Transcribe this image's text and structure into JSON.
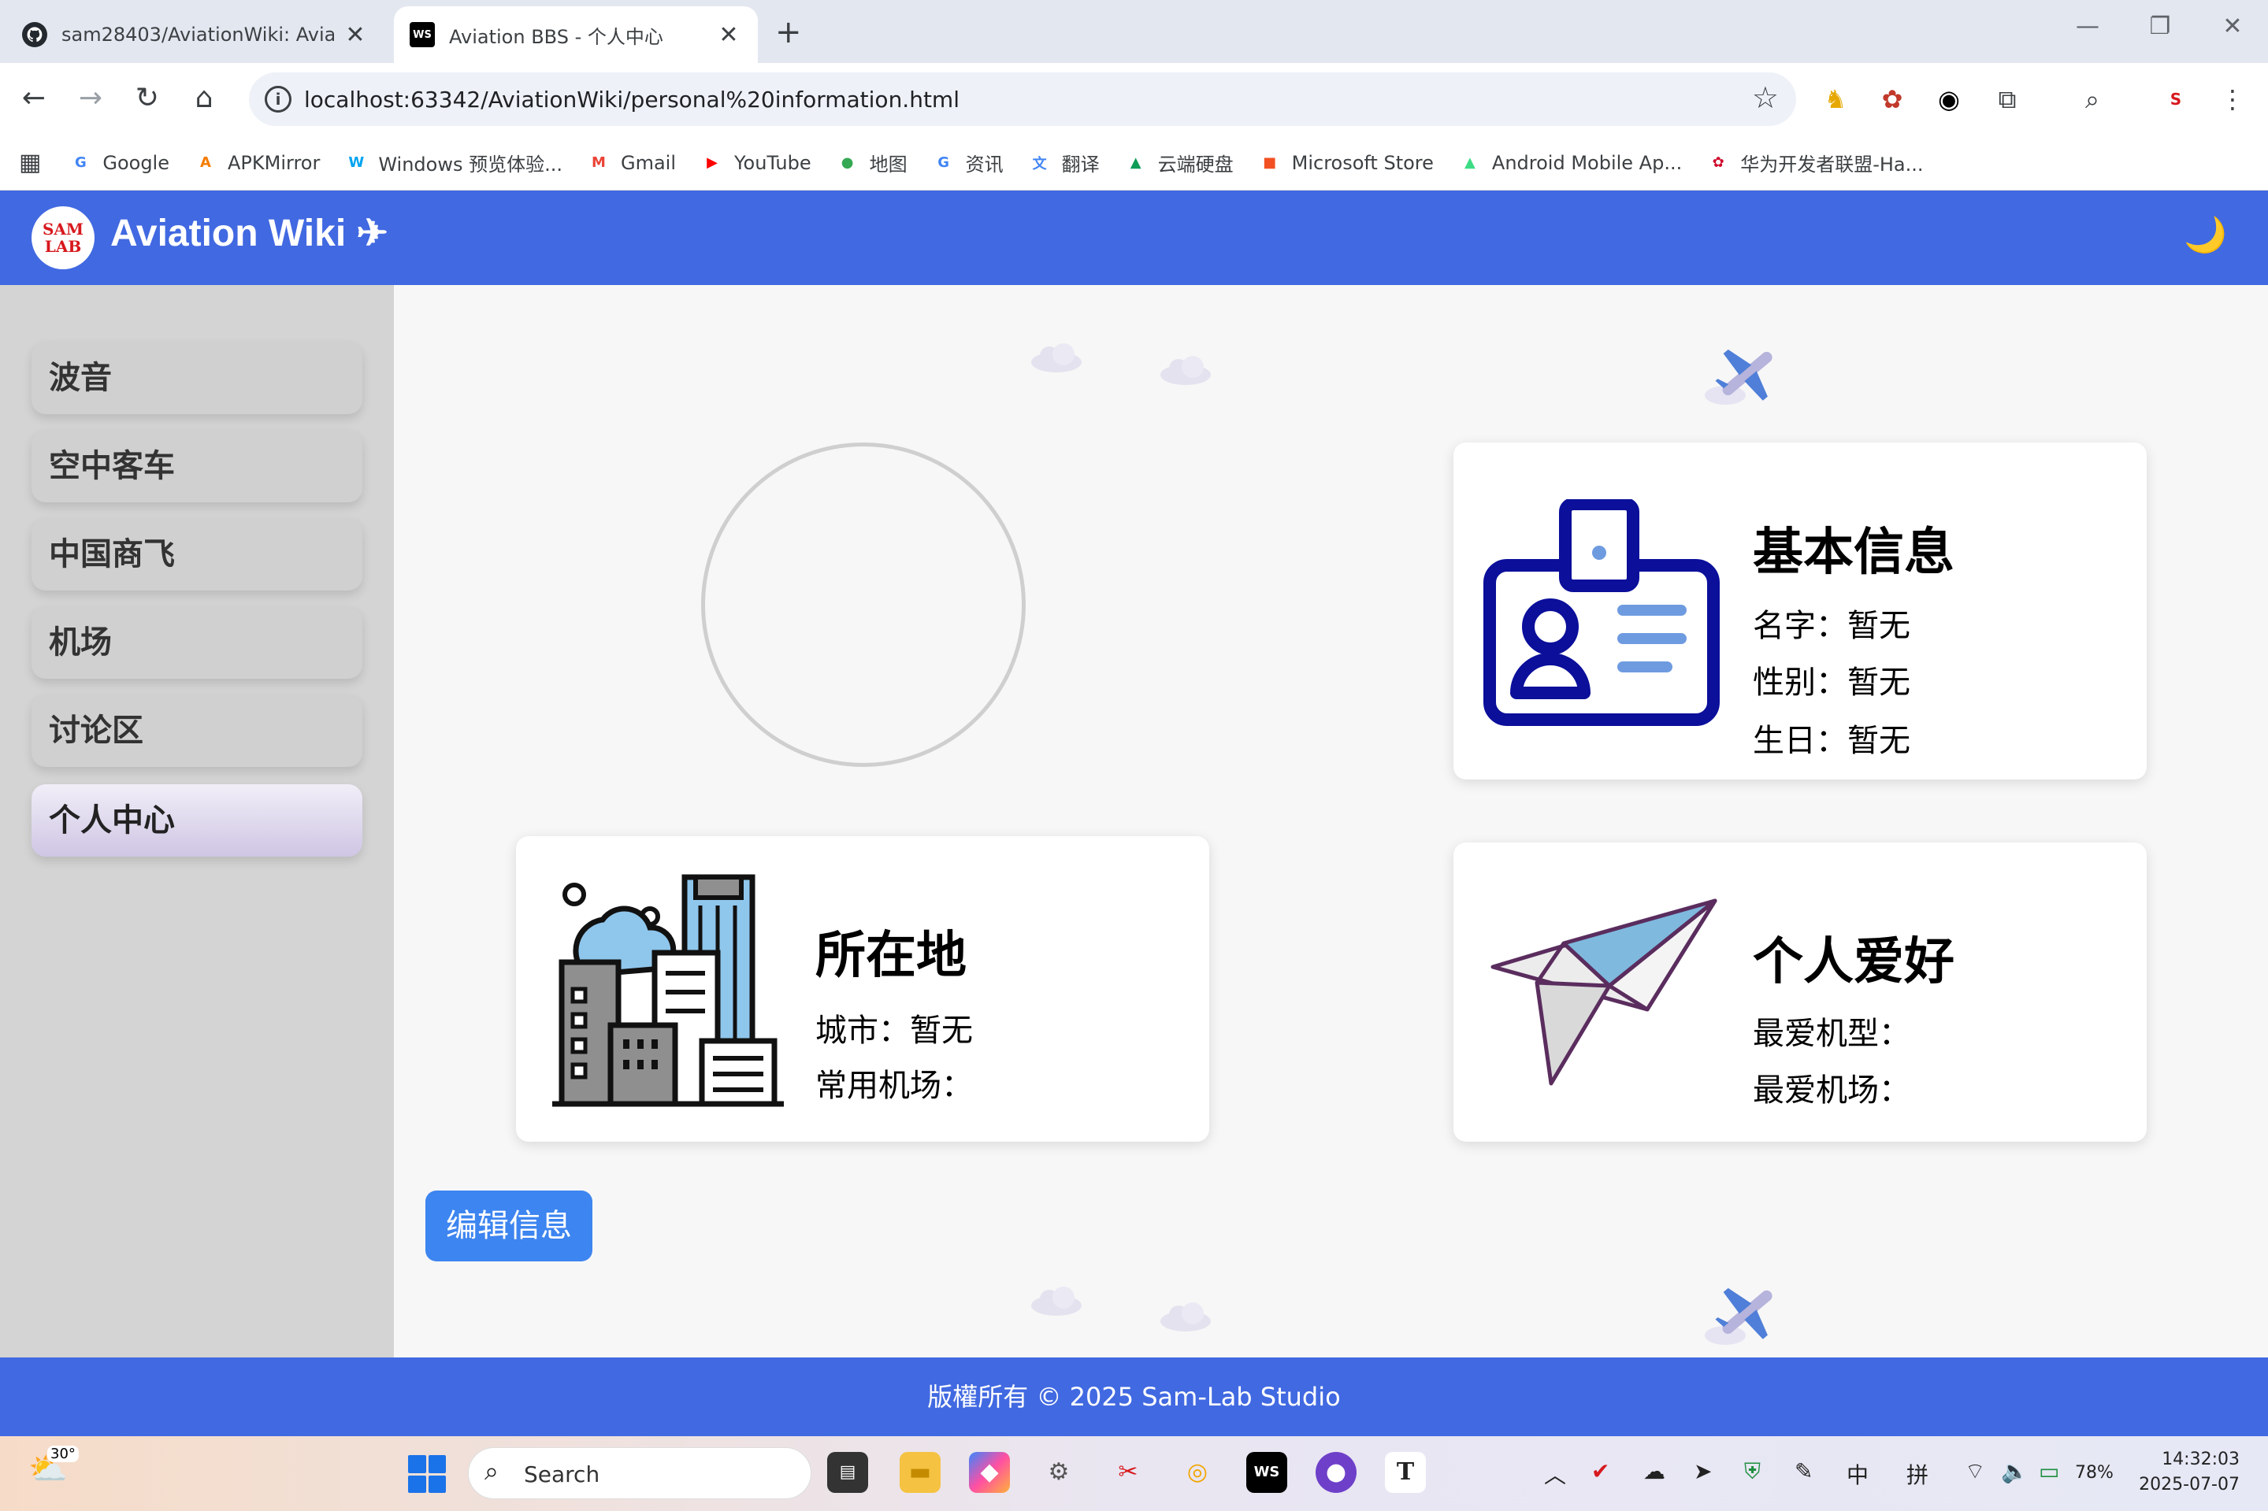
{
  "browser": {
    "tabs": [
      {
        "title": "sam28403/AviationWiki: Aviatio",
        "icon": "github-icon"
      },
      {
        "title": "Aviation BBS - 个人中心",
        "icon": "webstorm-icon",
        "badge": "WS"
      }
    ],
    "new_tab": "+",
    "url": "localhost:63342/AviationWiki/personal%20information.html",
    "bookmarks": [
      {
        "label": "Google",
        "icon": "G",
        "color": "#4285f4"
      },
      {
        "label": "APKMirror",
        "icon": "A",
        "color": "#f57c00"
      },
      {
        "label": "Windows 预览体验...",
        "icon": "W",
        "color": "#00a4ef"
      },
      {
        "label": "Gmail",
        "icon": "M",
        "color": "#ea4335"
      },
      {
        "label": "YouTube",
        "icon": "▶",
        "color": "#ff0000"
      },
      {
        "label": "地图",
        "icon": "●",
        "color": "#34a853"
      },
      {
        "label": "资讯",
        "icon": "G",
        "color": "#4285f4"
      },
      {
        "label": "翻译",
        "icon": "文",
        "color": "#4285f4"
      },
      {
        "label": "云端硬盘",
        "icon": "▲",
        "color": "#0f9d58"
      },
      {
        "label": "Microsoft Store",
        "icon": "■",
        "color": "#f25022"
      },
      {
        "label": "Android Mobile Ap...",
        "icon": "▲",
        "color": "#3ddc84"
      },
      {
        "label": "华为开发者联盟-Ha...",
        "icon": "✿",
        "color": "#cf0a2c"
      }
    ]
  },
  "header": {
    "logo_top": "SAM",
    "logo_bottom": "LAB",
    "title": "Aviation Wiki ✈",
    "theme_icon": "🌙"
  },
  "sidebar": {
    "items": [
      {
        "label": "波音"
      },
      {
        "label": "空中客车"
      },
      {
        "label": "中国商飞"
      },
      {
        "label": "机场"
      },
      {
        "label": "讨论区"
      },
      {
        "label": "个人中心",
        "active": true
      }
    ]
  },
  "cards": {
    "basic": {
      "title": "基本信息",
      "name": "名字：暂无",
      "gender": "性别：暂无",
      "birthday": "生日：暂无"
    },
    "location": {
      "title": "所在地",
      "city": "城市：暂无",
      "airport": "常用机场："
    },
    "hobby": {
      "title": "个人爱好",
      "aircraft": "最爱机型：",
      "airport": "最爱机场："
    }
  },
  "edit_button": "编辑信息",
  "footer": "版權所有 © 2025 Sam-Lab Studio",
  "taskbar": {
    "temperature": "30°",
    "search": "Search",
    "tray_input_1": "中",
    "tray_input_2": "拼",
    "battery": "78%",
    "time": "14:32:03",
    "date": "2025-07-07"
  },
  "colors": {
    "header": "#4169e1",
    "button": "#3d85f0",
    "active_item": "#cfc6e4",
    "icon_navy": "#0b0f9a"
  }
}
